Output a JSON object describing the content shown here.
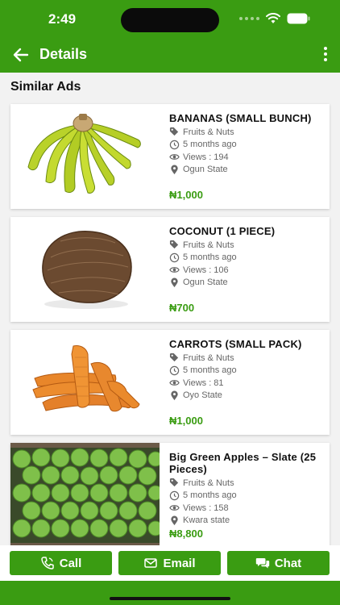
{
  "status_bar": {
    "time": "2:49"
  },
  "header": {
    "title": "Details"
  },
  "section": {
    "title": "Similar Ads"
  },
  "colors": {
    "brand": "#3a9c12",
    "price": "#3a9c12"
  },
  "ads": [
    {
      "title": "BANANAS (SMALL BUNCH)",
      "category": "Fruits & Nuts",
      "age": "5 months ago",
      "views": "Views : 194",
      "location": "Ogun State",
      "price": "₦1,000",
      "image_icon": "bananas-image"
    },
    {
      "title": "COCONUT (1 PIECE)",
      "category": "Fruits & Nuts",
      "age": "5 months ago",
      "views": "Views : 106",
      "location": "Ogun State",
      "price": "₦700",
      "image_icon": "coconut-image"
    },
    {
      "title": "CARROTS (SMALL PACK)",
      "category": "Fruits & Nuts",
      "age": "5 months ago",
      "views": "Views : 81",
      "location": "Oyo State",
      "price": "₦1,000",
      "image_icon": "carrots-image"
    },
    {
      "title": "Big Green Apples – Slate (25 Pieces)",
      "category": "Fruits & Nuts",
      "age": "5 months ago",
      "views": "Views : 158",
      "location": "Kwara state",
      "price": "₦8,800",
      "image_icon": "apples-image"
    }
  ],
  "actions": {
    "call": "Call",
    "email": "Email",
    "chat": "Chat"
  }
}
